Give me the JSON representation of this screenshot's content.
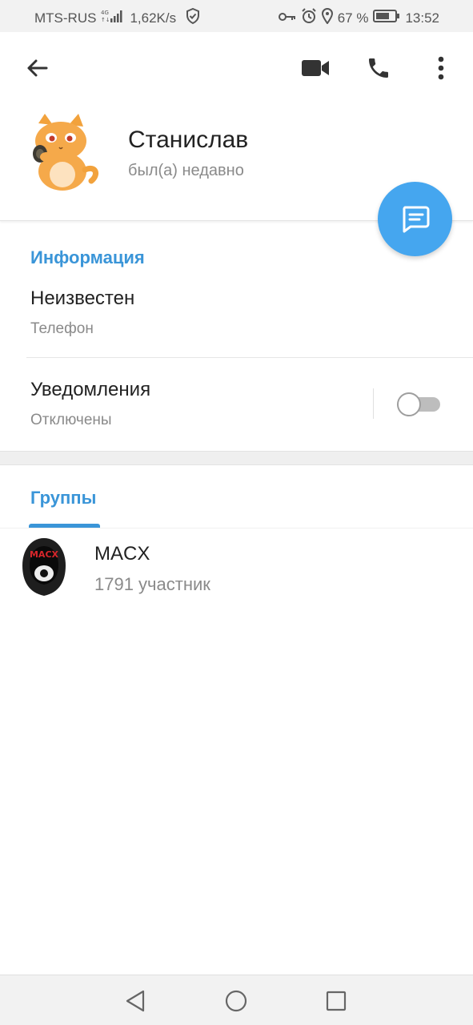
{
  "status_bar": {
    "carrier": "MTS-RUS",
    "network": "4G",
    "speed": "1,62K/s",
    "battery": "67 %",
    "time": "13:52"
  },
  "app_bar": {
    "icons": [
      "back-arrow-icon",
      "video-call-icon",
      "phone-icon",
      "more-vert-icon"
    ]
  },
  "profile": {
    "name": "Станислав",
    "status": "был(а) недавно",
    "avatar": "cat-sticker-avatar"
  },
  "info": {
    "title": "Информация",
    "phone_value": "Неизвестен",
    "phone_label": "Телефон",
    "notifications_title": "Уведомления",
    "notifications_state": "Отключены",
    "notifications_enabled": false
  },
  "groups": {
    "tab_label": "Группы",
    "items": [
      {
        "name": "MACX",
        "members": "1791 участник",
        "avatar_text": "MACX"
      }
    ]
  },
  "colors": {
    "accent": "#3a95d8",
    "fab": "#45a6ef",
    "secondary_text": "#8a8a8a"
  }
}
